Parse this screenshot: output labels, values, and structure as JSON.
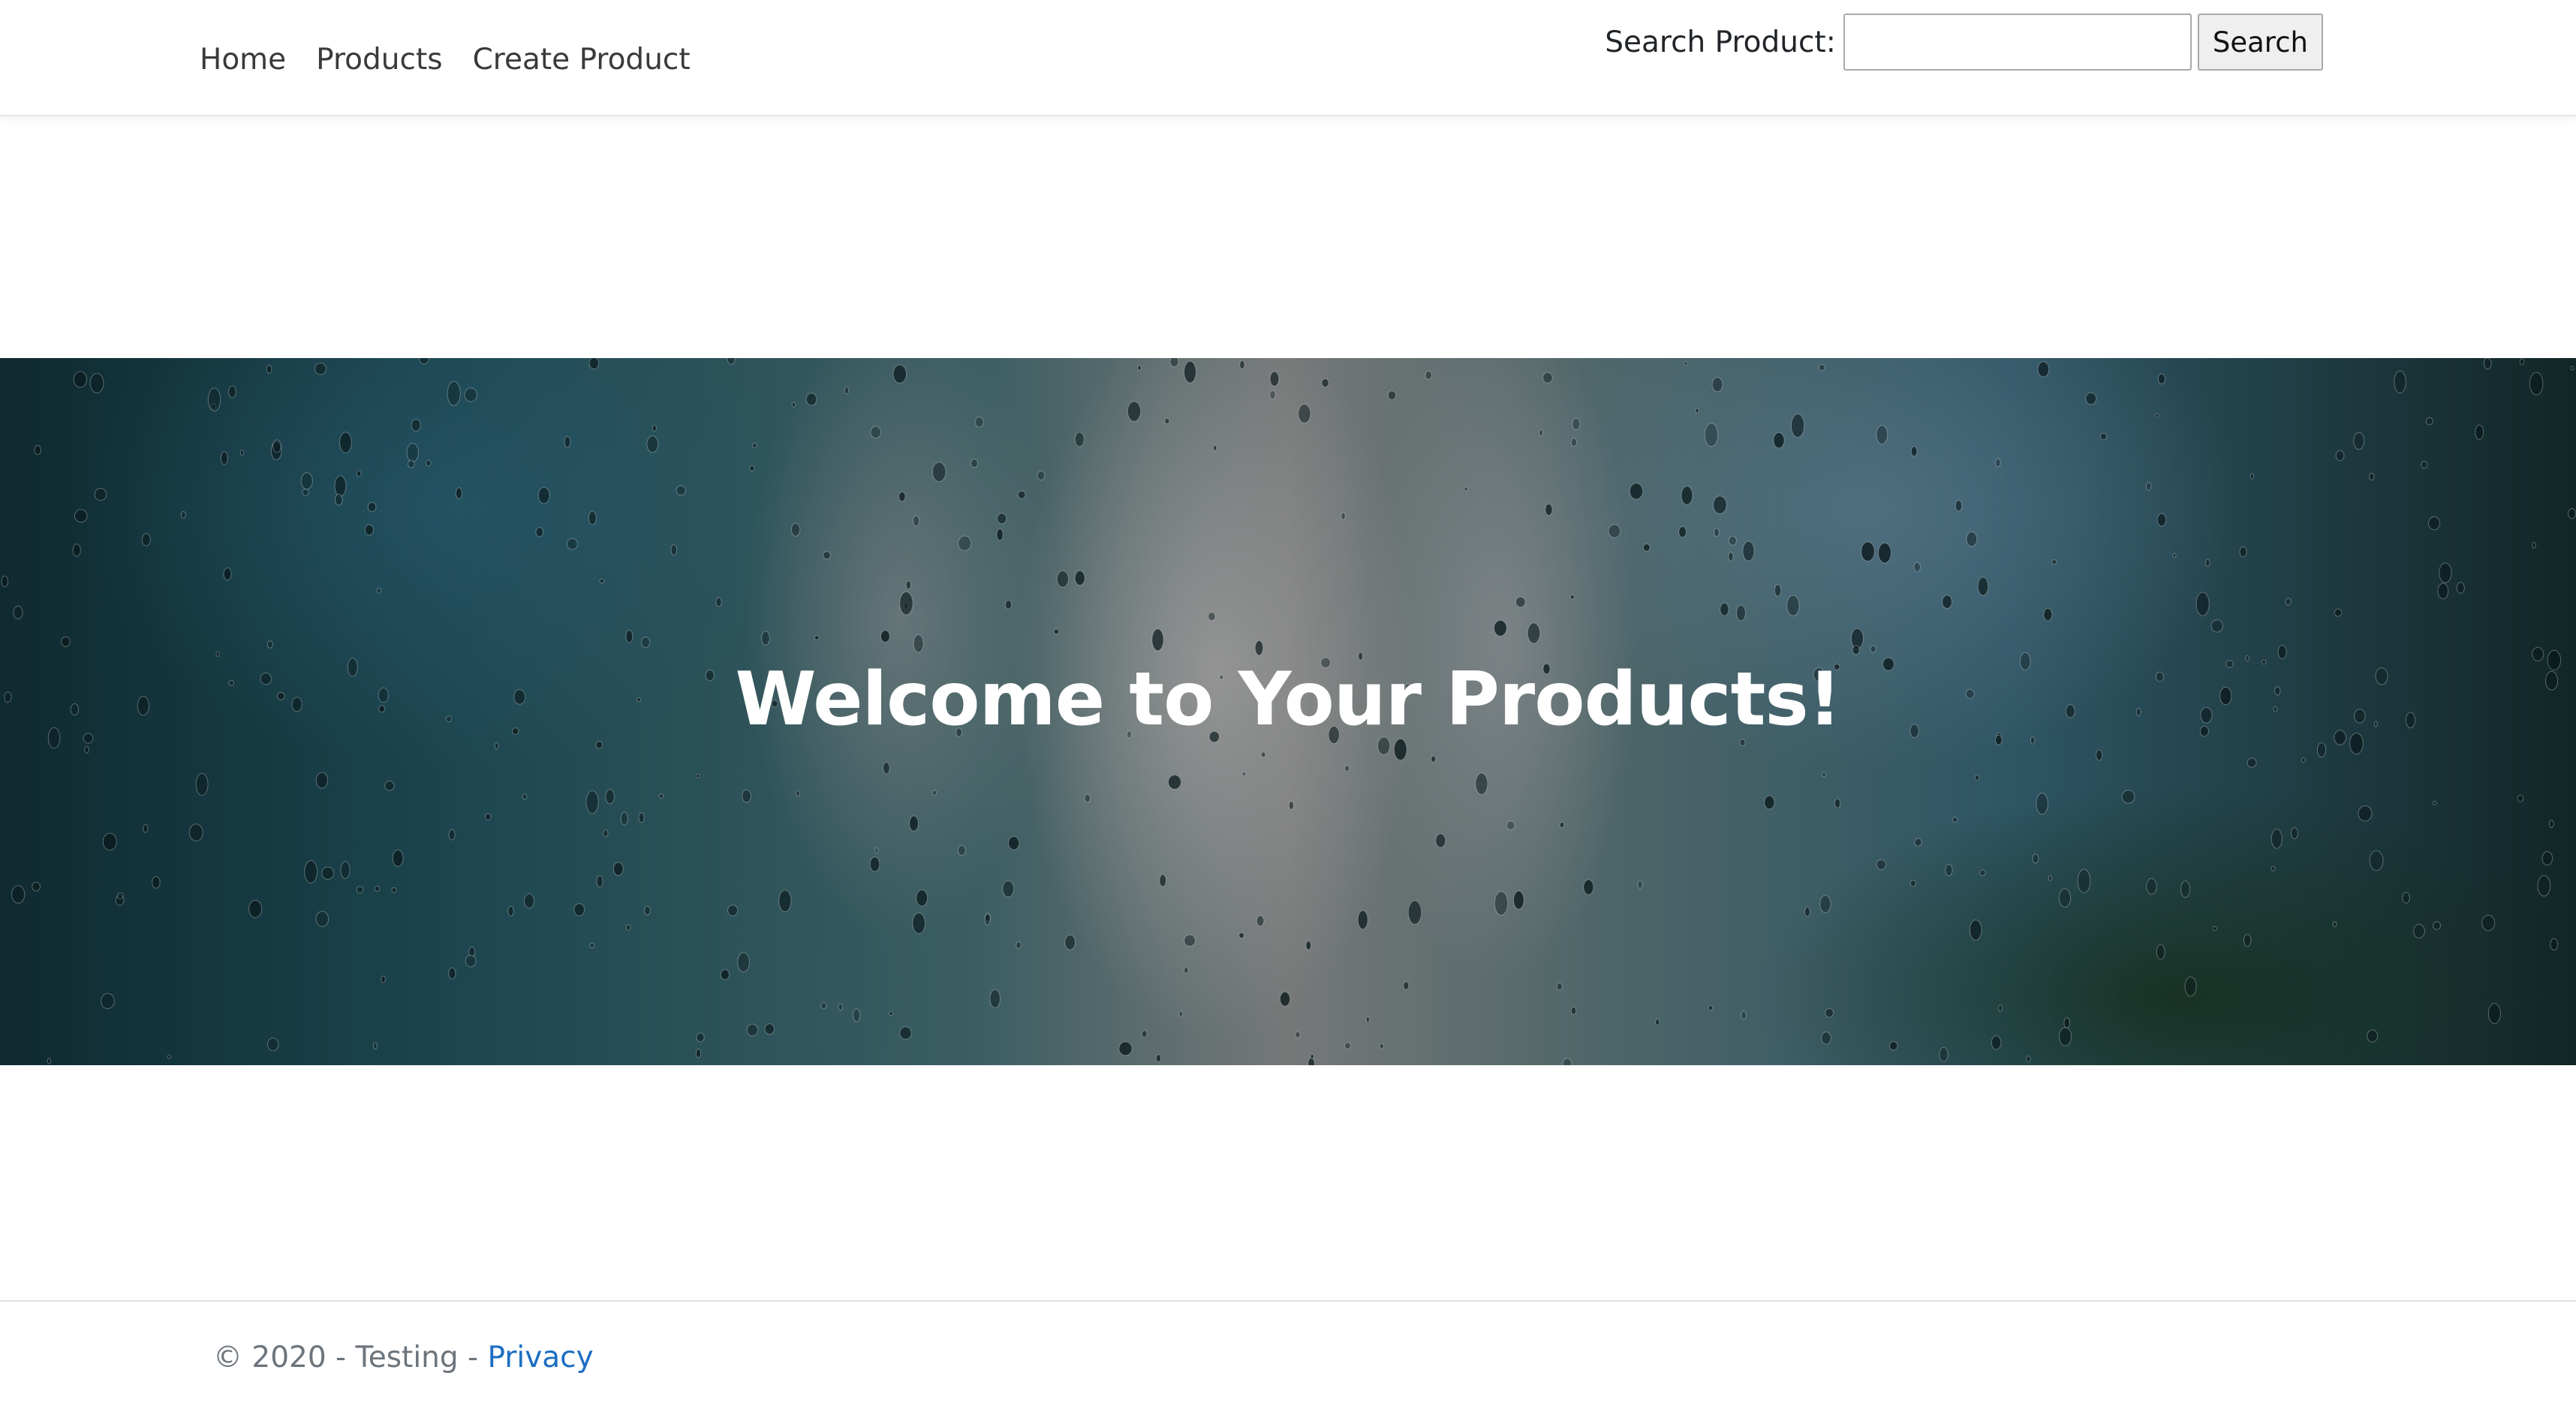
{
  "nav": {
    "links": [
      {
        "label": "Home"
      },
      {
        "label": "Products"
      },
      {
        "label": "Create Product"
      }
    ],
    "search": {
      "label": "Search Product:",
      "value": "",
      "button_label": "Search"
    }
  },
  "hero": {
    "title": "Welcome to Your Products!"
  },
  "footer": {
    "copyright": "© 2020 - Testing - ",
    "privacy_label": "Privacy"
  },
  "colors": {
    "link": "#1b6ec2",
    "footer_text": "#6c757d",
    "hero_text": "#ffffff"
  }
}
